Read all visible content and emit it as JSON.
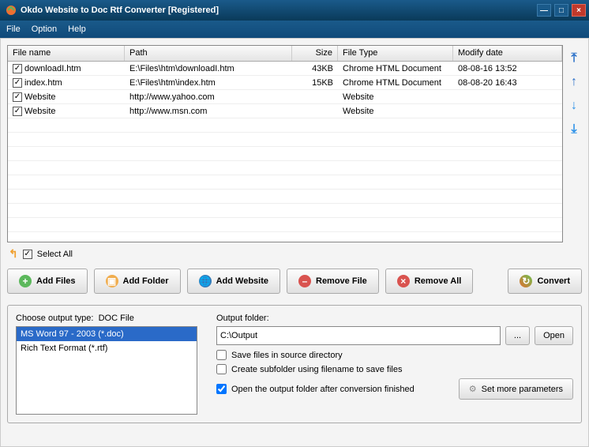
{
  "window": {
    "title": "Okdo Website to Doc Rtf Converter [Registered]"
  },
  "menu": {
    "file": "File",
    "option": "Option",
    "help": "Help"
  },
  "columns": {
    "name": "File name",
    "path": "Path",
    "size": "Size",
    "type": "File Type",
    "mdate": "Modify date"
  },
  "rows": [
    {
      "checked": true,
      "name": "downloadI.htm",
      "path": "E:\\Files\\htm\\downloadI.htm",
      "size": "43KB",
      "type": "Chrome HTML Document",
      "mdate": "08-08-16 13:52"
    },
    {
      "checked": true,
      "name": "index.htm",
      "path": "E:\\Files\\htm\\index.htm",
      "size": "15KB",
      "type": "Chrome HTML Document",
      "mdate": "08-08-20 16:43"
    },
    {
      "checked": true,
      "name": "Website",
      "path": "http://www.yahoo.com",
      "size": "",
      "type": "Website",
      "mdate": ""
    },
    {
      "checked": true,
      "name": "Website",
      "path": "http://www.msn.com",
      "size": "",
      "type": "Website",
      "mdate": ""
    }
  ],
  "selectall": {
    "label": "Select All"
  },
  "buttons": {
    "addFiles": "Add Files",
    "addFolder": "Add Folder",
    "addWebsite": "Add Website",
    "removeFile": "Remove File",
    "removeAll": "Remove All",
    "convert": "Convert"
  },
  "outputType": {
    "label": "Choose output type:",
    "current": "DOC File",
    "items": [
      {
        "label": "MS Word 97 - 2003 (*.doc)",
        "selected": true
      },
      {
        "label": "Rich Text Format (*.rtf)",
        "selected": false
      }
    ]
  },
  "outputFolder": {
    "label": "Output folder:",
    "value": "C:\\Output",
    "browse": "...",
    "open": "Open",
    "saveInSource": "Save files in source directory",
    "createSubfolder": "Create subfolder using filename to save files",
    "openAfter": "Open the output folder after conversion finished",
    "openAfterChecked": true,
    "setParams": "Set more parameters"
  }
}
